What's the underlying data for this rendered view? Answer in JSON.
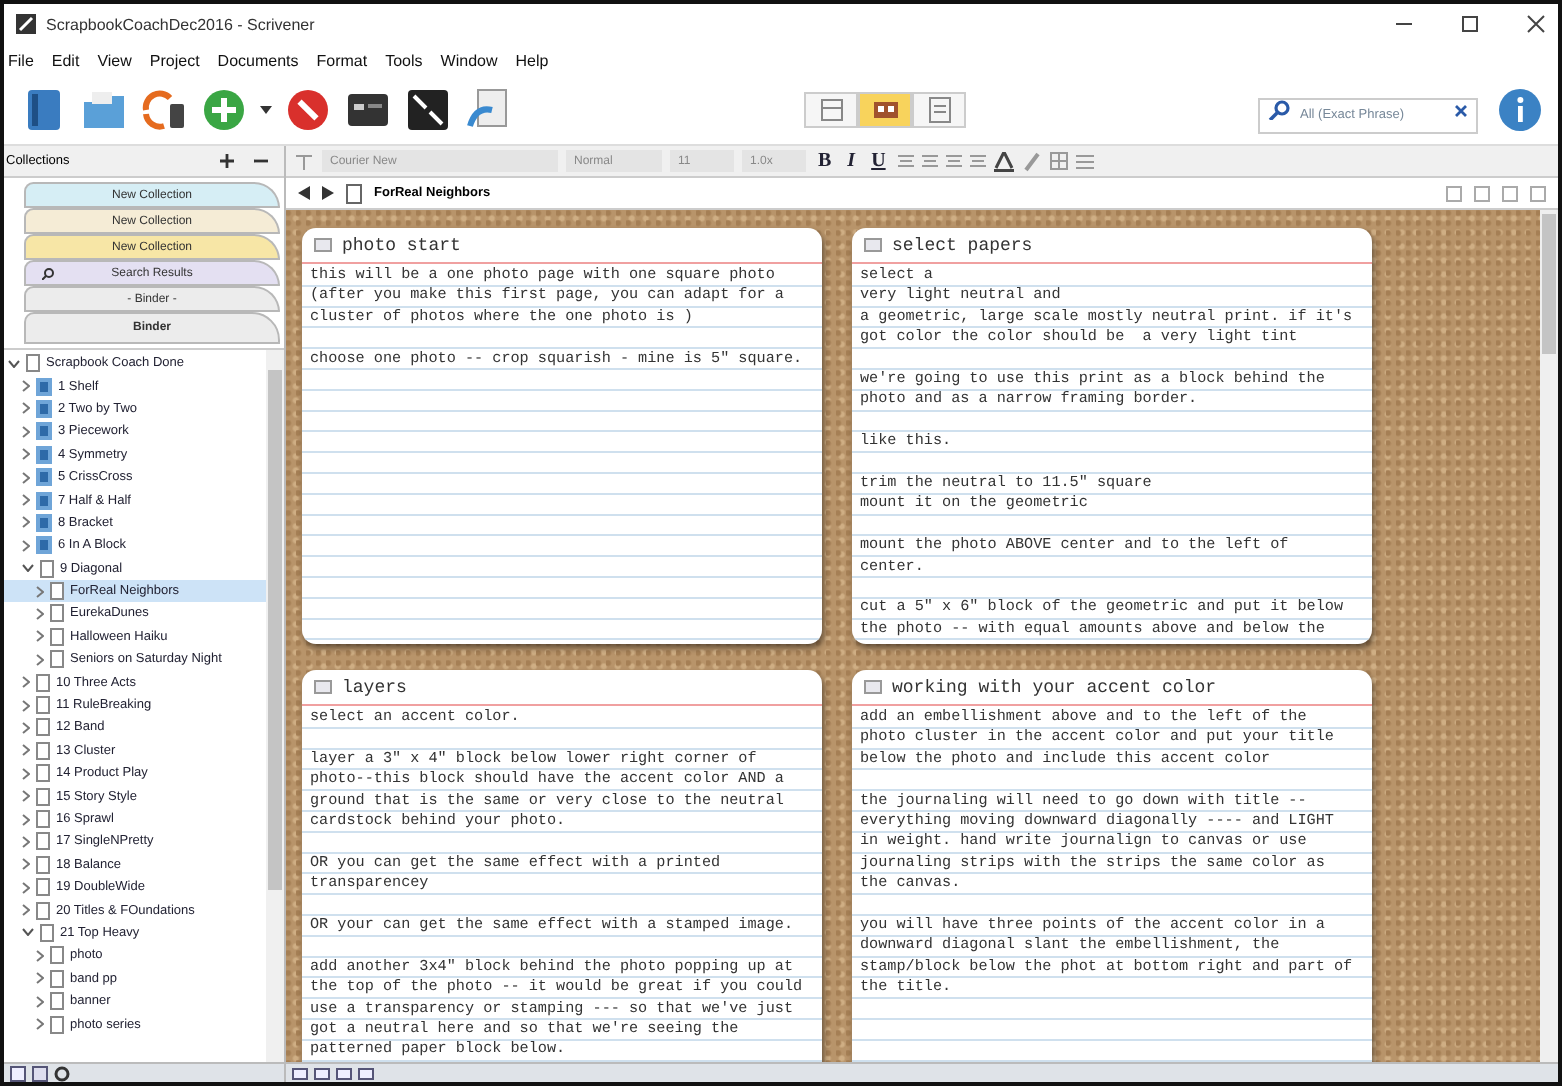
{
  "window": {
    "title": "ScrapbookCoachDec2016 - Scrivener"
  },
  "menu": [
    "File",
    "Edit",
    "View",
    "Project",
    "Documents",
    "Format",
    "Tools",
    "Window",
    "Help"
  ],
  "view_modes": [
    {
      "kind": "outline",
      "selected": false
    },
    {
      "kind": "corkboard",
      "selected": true
    },
    {
      "kind": "scrivenings",
      "selected": false
    }
  ],
  "search": {
    "placeholder": "All (Exact Phrase)"
  },
  "sidebar": {
    "header": "Collections",
    "collections": [
      {
        "label": "New Collection",
        "color": "#d6eef5",
        "kind": "plain",
        "selected": false
      },
      {
        "label": "New Collection",
        "color": "#f5ecd6",
        "kind": "plain",
        "selected": false
      },
      {
        "label": "New Collection",
        "color": "#f7e6a6",
        "kind": "plain",
        "selected": false
      },
      {
        "label": "Search Results",
        "color": "#e4e0f2",
        "kind": "search",
        "selected": false
      },
      {
        "label": "- Binder -",
        "color": "#ececec",
        "kind": "plain",
        "selected": false
      },
      {
        "label": "Binder",
        "color": "#ececec",
        "kind": "plain",
        "selected": true
      }
    ],
    "tree": [
      {
        "label": "Scrapbook Coach Done",
        "kind": "doc",
        "expanded": true,
        "selected": false,
        "children": [
          {
            "label": "1 Shelf",
            "kind": "stack",
            "expanded": false,
            "selected": false
          },
          {
            "label": "2 Two by Two",
            "kind": "stack",
            "expanded": false,
            "selected": false
          },
          {
            "label": "3 Piecework",
            "kind": "stack",
            "expanded": false,
            "selected": false
          },
          {
            "label": "4 Symmetry",
            "kind": "stack",
            "expanded": false,
            "selected": false
          },
          {
            "label": "5 CrissCross",
            "kind": "stack",
            "expanded": false,
            "selected": false
          },
          {
            "label": "7 Half & Half",
            "kind": "stack",
            "expanded": false,
            "selected": false
          },
          {
            "label": "8 Bracket",
            "kind": "stack",
            "expanded": false,
            "selected": false
          },
          {
            "label": "6 In A Block",
            "kind": "stack",
            "expanded": false,
            "selected": false
          },
          {
            "label": "9 Diagonal",
            "kind": "doc",
            "expanded": true,
            "selected": false,
            "children": [
              {
                "label": "ForReal Neighbors",
                "kind": "doc",
                "expanded": false,
                "selected": true
              },
              {
                "label": "EurekaDunes",
                "kind": "doc",
                "expanded": false,
                "selected": false
              },
              {
                "label": "Halloween Haiku",
                "kind": "doc",
                "expanded": false,
                "selected": false
              },
              {
                "label": "Seniors on Saturday Night",
                "kind": "doc",
                "expanded": false,
                "selected": false
              }
            ]
          },
          {
            "label": "10 Three Acts",
            "kind": "doc",
            "expanded": false,
            "selected": false
          },
          {
            "label": "11 RuleBreaking",
            "kind": "doc",
            "expanded": false,
            "selected": false
          },
          {
            "label": "12 Band",
            "kind": "doc",
            "expanded": false,
            "selected": false
          },
          {
            "label": "13 Cluster",
            "kind": "doc",
            "expanded": false,
            "selected": false
          },
          {
            "label": "14 Product Play",
            "kind": "doc",
            "expanded": false,
            "selected": false
          },
          {
            "label": "15 Story Style",
            "kind": "doc",
            "expanded": false,
            "selected": false
          },
          {
            "label": "16 Sprawl",
            "kind": "doc",
            "expanded": false,
            "selected": false
          },
          {
            "label": "17 SingleNPretty",
            "kind": "doc",
            "expanded": false,
            "selected": false
          },
          {
            "label": "18 Balance",
            "kind": "doc",
            "expanded": false,
            "selected": false
          },
          {
            "label": "19 DoubleWide",
            "kind": "doc",
            "expanded": false,
            "selected": false
          },
          {
            "label": "20 Titles & FOundations",
            "kind": "doc",
            "expanded": false,
            "selected": false
          },
          {
            "label": "21 Top Heavy",
            "kind": "doc",
            "expanded": true,
            "selected": false,
            "children": [
              {
                "label": "photo",
                "kind": "doc",
                "expanded": false,
                "selected": false
              },
              {
                "label": "band pp",
                "kind": "doc",
                "expanded": false,
                "selected": false
              },
              {
                "label": "banner",
                "kind": "doc",
                "expanded": false,
                "selected": false
              },
              {
                "label": "photo series",
                "kind": "doc",
                "expanded": false,
                "selected": false
              }
            ]
          }
        ]
      }
    ]
  },
  "format_bar": {
    "font": "Courier New",
    "style": "Normal",
    "size": "11",
    "spacing": "1.0x",
    "bold": "B",
    "italic": "I",
    "underline": "U"
  },
  "editor": {
    "document": "ForReal Neighbors",
    "cards": [
      {
        "title": "photo start",
        "paragraphs": [
          "this will be a one photo page with one square photo\n(after you make this first page, you can adapt for a\ncluster of photos where the one photo is )",
          "choose one photo -- crop squarish - mine is 5\" square."
        ]
      },
      {
        "title": "select papers",
        "paragraphs": [
          "select a\nvery light neutral and\na geometric, large scale mostly neutral print. if it's\ngot color the color should be  a very light tint",
          "we're going to use this print as a block behind the\nphoto and as a narrow framing border.",
          "like this.",
          "trim the neutral to 11.5\" square\nmount it on the geometric",
          "mount the photo ABOVE center and to the left of\ncenter.",
          "cut a 5\" x 6\" block of the geometric and put it below\nthe photo -- with equal amounts above and below the"
        ]
      },
      {
        "title": "layers",
        "paragraphs": [
          "select an accent color.",
          "layer a 3\" x 4\" block below lower right corner of\nphoto--this block should have the accent color AND a\nground that is the same or very close to the neutral\ncardstock behind your photo.",
          "OR you can get the same effect with a printed\ntransparencey",
          "OR your can get the same effect with a stamped image.",
          "add another 3x4\" block behind the photo popping up at\nthe top of the photo -- it would be great if you could\nuse a transparency or stamping --- so that we've just\ngot a neutral here and so that we're seeing the\npatterned paper block below."
        ]
      },
      {
        "title": "working with your accent color",
        "paragraphs": [
          "add an embellishment above and to the left of the\nphoto cluster in the accent color and put your title\nbelow the photo and include this accent color",
          "the journaling will need to go down with title --\neverything moving downward diagonally ---- and LIGHT\nin weight. hand write journalign to canvas or use\njournaling strips with the strips the same color as\nthe canvas.\n",
          "you will have three points of the accent color in a\ndownward diagonal slant the embellishment, the\nstamp/block below the phot at bottom right and part of\nthe title."
        ]
      }
    ]
  }
}
